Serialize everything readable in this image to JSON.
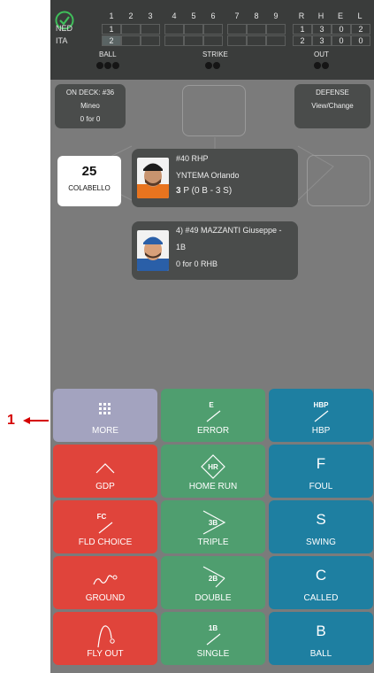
{
  "callout": {
    "label": "1"
  },
  "scoreboard": {
    "innings": [
      "1",
      "2",
      "3",
      "4",
      "5",
      "6",
      "7",
      "8",
      "9"
    ],
    "teams": [
      {
        "name": "NED",
        "scores": [
          "1",
          "",
          "",
          "",
          "",
          "",
          "",
          "",
          ""
        ],
        "r": "1",
        "h": "3",
        "e": "0",
        "l": "2"
      },
      {
        "name": "ITA",
        "scores": [
          "2",
          "",
          "",
          "",
          "",
          "",
          "",
          "",
          ""
        ],
        "r": "2",
        "h": "3",
        "e": "0",
        "l": "0"
      }
    ],
    "totals_headers": {
      "r": "R",
      "h": "H",
      "e": "E",
      "l": "L"
    },
    "count": {
      "ball_label": "BALL",
      "strike_label": "STRIKE",
      "out_label": "OUT"
    }
  },
  "on_deck": {
    "title": "ON DECK: #36",
    "name": "Mineo",
    "stats": "0 for 0"
  },
  "defense": {
    "title": "DEFENSE",
    "action": "View/Change"
  },
  "runner_first": {
    "number": "25",
    "name": "COLABELLO"
  },
  "pitcher": {
    "line1": "#40 RHP",
    "line2": "YNTEMA Orlando",
    "pitch_count": "3",
    "pitch_detail": " P (0 B - 3 S)"
  },
  "batter": {
    "line1": "4) #49 MAZZANTI Giuseppe -",
    "line2": "1B",
    "line3": "0 for 0 RHB"
  },
  "buttons": {
    "more": "MORE",
    "error": "ERROR",
    "error_icon": "E",
    "hbp": "HBP",
    "hbp_icon": "HBP",
    "gdp": "GDP",
    "home_run": "HOME RUN",
    "home_run_icon": "HR",
    "foul": "FOUL",
    "foul_letter": "F",
    "fld_choice": "FLD CHOICE",
    "fld_choice_icon": "FC",
    "triple": "TRIPLE",
    "triple_icon": "3B",
    "swing": "SWING",
    "swing_letter": "S",
    "ground": "GROUND",
    "double": "DOUBLE",
    "double_icon": "2B",
    "called": "CALLED",
    "called_letter": "C",
    "fly_out": "FLY OUT",
    "single": "SINGLE",
    "single_icon": "1B",
    "ball": "BALL",
    "ball_letter": "B"
  },
  "colors": {
    "red": "#e0443b",
    "green": "#4f9e6f",
    "blue": "#1e7fa1",
    "purple": "#a3a3bf",
    "panel": "#4a4c4b",
    "scoreboard": "#3a3c3b"
  }
}
